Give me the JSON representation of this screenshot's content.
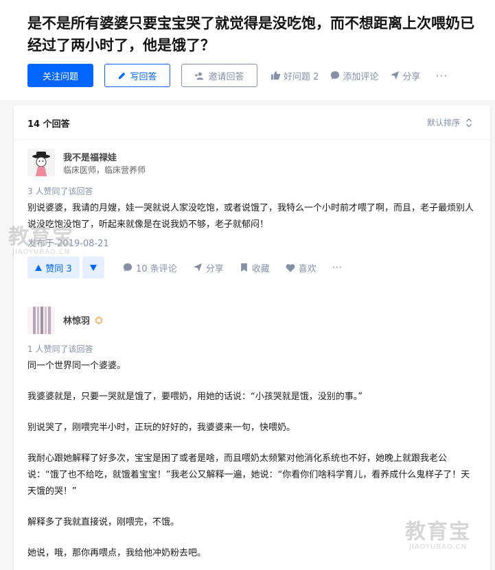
{
  "question": {
    "title": "是不是所有婆婆只要宝宝哭了就觉得是没吃饱，而不想距离上次喂奶已经过了两小时了，他是饿了？"
  },
  "actions": {
    "follow": "关注问题",
    "write": "写回答",
    "invite": "邀请回答",
    "good_question": "好问题 2",
    "add_comment": "添加评论",
    "share": "分享",
    "more": "···"
  },
  "list": {
    "count": "14 个回答",
    "sort": "默认排序"
  },
  "answers": [
    {
      "author_name": "我不是福禄娃",
      "author_desc": "临床医师，临床营养师",
      "votes_text": "3 人赞同了该回答",
      "paragraphs": [
        "别说婆婆，我请的月嫂，娃一哭就说人家没吃饱，或者说饿了，我特么一个小时前才喂了啊，而且，老子最烦别人说没吃饱没饱了，听起来就像是在说我奶不够，老子就郁闷！"
      ],
      "date": "发布于 2019-08-21",
      "vote_label": "赞同 3",
      "comments": "10 条评论",
      "share": "分享",
      "collect": "收藏",
      "like": "喜欢",
      "more": "···"
    },
    {
      "author_name": "林惊羽",
      "votes_text": "1 人赞同了该回答",
      "paragraphs": [
        "同一个世界同一个婆婆。",
        "我婆婆就是，只要一哭就是饿了，要喂奶，用她的话说：“小孩哭就是饿，没别的事。”",
        "别说哭了，刚喂完半小时，正玩的好好的，我婆婆来一句，快喂奶。",
        "我耐心跟她解释了好多次，宝宝是困了或者是啥，而且喂奶太频繁对他消化系统也不好，她晚上就跟我老公说：“饿了也不给吃，就饿着宝宝！”我老公又解释一遍，她说：“你看你们啥科学育儿，看养成什么鬼样子了！天天饿的哭！”",
        "解释多了我就直接说，刚喂完，不饿。",
        "她说，哦，那你再喂点，我给他冲奶粉去吧。"
      ]
    }
  ],
  "watermark": {
    "text": "教育宝",
    "url": "JIAOYUBAO.CN"
  },
  "colors": {
    "brand": "#0066ff",
    "muted": "#8590a6",
    "vote_bg": "#e5efff"
  }
}
